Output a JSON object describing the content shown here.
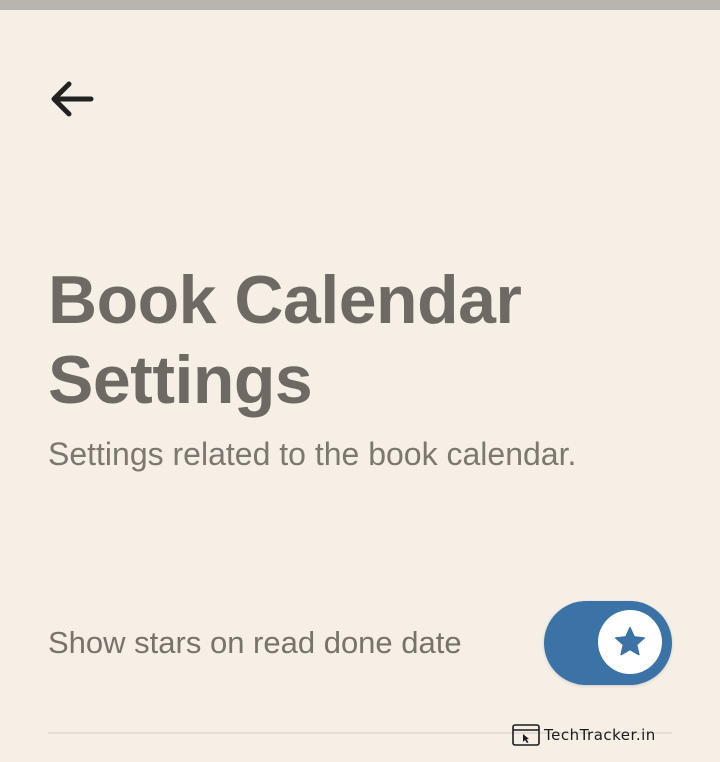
{
  "header": {
    "back_icon": "arrow-left-icon"
  },
  "page": {
    "title_line1": "Book Calendar",
    "title_line2": "Settings",
    "subtitle": "Settings related to the book calendar."
  },
  "settings": [
    {
      "label": "Show stars on read done date",
      "enabled": true,
      "toggle_icon": "star-icon"
    }
  ],
  "watermark": {
    "text": "TechTracker.in",
    "icon": "browser-cursor-icon"
  },
  "colors": {
    "background": "#f6efe6",
    "title": "#6e6a63",
    "text": "#77726a",
    "accent": "#3b73a6"
  }
}
